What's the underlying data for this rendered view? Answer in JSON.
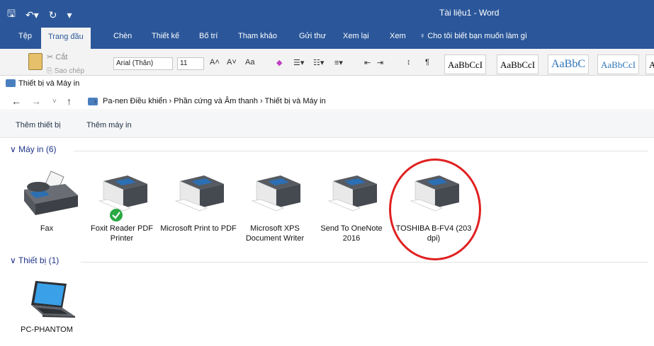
{
  "word": {
    "doc_title": "Tài liệu1 - Word",
    "tabs": [
      "Tệp",
      "Trang đầu",
      "Chèn",
      "Thiết kế",
      "Bố trí",
      "Tham khảo",
      "Gửi thư",
      "Xem lại",
      "Xem"
    ],
    "tell_me": "Cho tôi biết bạn muốn làm gì",
    "ribbon": {
      "cut": "Cắt",
      "copy": "Sao chép",
      "font_name": "Arial (Thân)",
      "font_size": "11",
      "case_btn": "Aa",
      "styles": [
        "AaBbCcI",
        "AaBbCcI",
        "AaBbC",
        "AaBbCcI",
        "A"
      ]
    }
  },
  "explorer": {
    "window_title": "Thiết bị và Máy in",
    "breadcrumb": "Pa-nen Điều khiển  ›  Phần cứng và Âm thanh  ›  Thiết bị và Máy in",
    "commands": [
      "Thêm thiết bị",
      "Thêm máy in"
    ],
    "groups": {
      "printers": "Máy in (6)",
      "devices": "Thiết bị (1)"
    },
    "printers": [
      {
        "name": "Fax",
        "icon": "fax-icon",
        "default": false
      },
      {
        "name": "Foxit Reader PDF Printer",
        "icon": "printer-icon",
        "default": true
      },
      {
        "name": "Microsoft Print to PDF",
        "icon": "printer-icon",
        "default": false
      },
      {
        "name": "Microsoft XPS Document Writer",
        "icon": "printer-icon",
        "default": false
      },
      {
        "name": "Send To OneNote 2016",
        "icon": "printer-icon",
        "default": false
      },
      {
        "name": "TOSHIBA B-FV4 (203 dpi)",
        "icon": "printer-icon",
        "default": false,
        "highlighted": true
      }
    ],
    "devices": [
      {
        "name": "PC-PHANTOM",
        "icon": "laptop-icon"
      }
    ]
  },
  "colors": {
    "word_blue": "#2b579a",
    "group_title": "#1e3287",
    "highlight": "#e02020",
    "default_check": "#2aa844"
  }
}
